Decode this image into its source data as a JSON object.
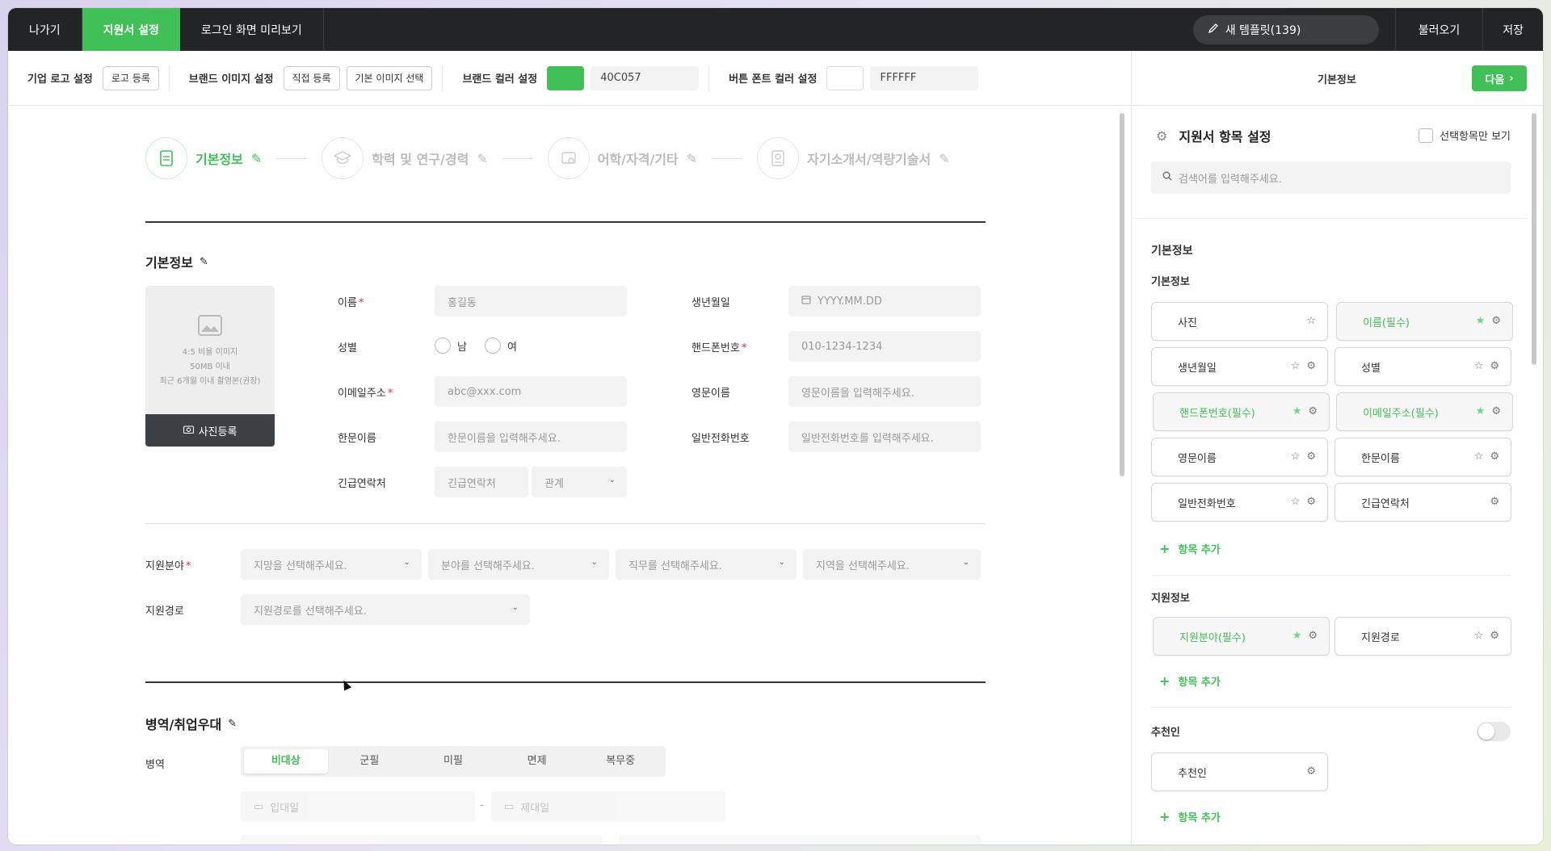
{
  "topbar": {
    "tabs": [
      "나가기",
      "지원서 설정",
      "로그인 화면 미리보기"
    ],
    "template_label": "새 템플릿(139)",
    "load_label": "불러오기",
    "save_label": "저장"
  },
  "toolbar": {
    "logo_label": "기업 로고 설정",
    "logo_btn": "로고 등록",
    "brand_image_label": "브랜드 이미지 설정",
    "direct_btn": "직접 등록",
    "default_btn": "기본 이미지 선택",
    "brand_color_label": "브랜드 컬러 설정",
    "brand_color_hex": "40C057",
    "brand_color": "#40C057",
    "button_font_label": "버튼 폰트 컬러 설정",
    "button_font_hex": "FFFFFF",
    "panel_title": "기본정보",
    "next_label": "다음"
  },
  "steps": [
    {
      "label": "기본정보",
      "active": true
    },
    {
      "label": "학력 및 연구/경력",
      "active": false
    },
    {
      "label": "어학/자격/기타",
      "active": false
    },
    {
      "label": "자기소개서/역량기술서",
      "active": false
    }
  ],
  "basic": {
    "title": "기본정보",
    "photo_lines": [
      "4:5 비율 이미지",
      "50MB 이내",
      "최근 6개월 이내 촬영본(권장)"
    ],
    "photo_btn": "사진등록",
    "name_label": "이름",
    "name_ph": "홍길동",
    "birth_label": "생년월일",
    "birth_ph": "YYYY.MM.DD",
    "gender_label": "성별",
    "male": "남",
    "female": "여",
    "phone_label": "핸드폰번호",
    "phone_ph": "010-1234-1234",
    "email_label": "이메일주소",
    "email_ph": "abc@xxx.com",
    "eng_label": "영문이름",
    "eng_ph": "영문이름을 입력해주세요.",
    "hanja_label": "한문이름",
    "hanja_ph": "한문이름을 입력해주세요.",
    "tel_label": "일반전화번호",
    "tel_ph": "일반전화번호를 입력해주세요.",
    "emerg_label": "긴급연락처",
    "emerg_ph": "긴급연락처",
    "relation_ph": "관계"
  },
  "apply": {
    "field_label": "지원분야",
    "field_selects": [
      "지망을 선택해주세요.",
      "분야를 선택해주세요.",
      "직무를 선택해주세요.",
      "지역을 선택해주세요."
    ],
    "route_label": "지원경로",
    "route_ph": "지원경로를 선택해주세요."
  },
  "military": {
    "title": "병역/취업우대",
    "label": "병역",
    "options": [
      "비대상",
      "군필",
      "미필",
      "면제",
      "복무중"
    ],
    "selected": "비대상",
    "start_ph": "입대일",
    "end_ph": "제대일",
    "dash": "-"
  },
  "rpanel": {
    "title": "지원서 항목 설정",
    "check_label": "선택항목만 보기",
    "search_ph": "검색어를 입력해주세요.",
    "group_title": "기본정보",
    "sub1": "기본정보",
    "chips1": [
      {
        "label": "사진",
        "required": false,
        "star": true,
        "gear": false
      },
      {
        "label": "이름(필수)",
        "required": true,
        "star": true,
        "gear": true
      },
      {
        "label": "생년월일",
        "required": false,
        "star": true,
        "gear": true
      },
      {
        "label": "성별",
        "required": false,
        "star": true,
        "gear": true
      },
      {
        "label": "핸드폰번호(필수)",
        "required": true,
        "star": true,
        "gear": true
      },
      {
        "label": "이메일주소(필수)",
        "required": true,
        "star": true,
        "gear": true
      },
      {
        "label": "영문이름",
        "required": false,
        "star": true,
        "gear": true
      },
      {
        "label": "한문이름",
        "required": false,
        "star": true,
        "gear": true
      },
      {
        "label": "일반전화번호",
        "required": false,
        "star": true,
        "gear": true
      },
      {
        "label": "긴급연락처",
        "required": false,
        "star": false,
        "gear": true
      }
    ],
    "add_label": "항목 추가",
    "sub2": "지원정보",
    "chips2": [
      {
        "label": "지원분야(필수)",
        "required": true
      },
      {
        "label": "지원경로",
        "required": false
      }
    ],
    "sub3": "추천인",
    "chip3": "추천인"
  }
}
